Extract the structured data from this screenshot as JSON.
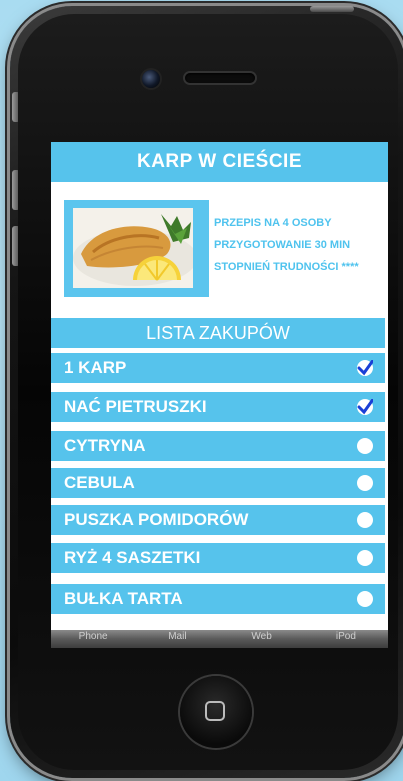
{
  "recipe": {
    "title": "KARP W CIEŚCIE",
    "info": [
      "PRZEPIS NA 4 OSOBY",
      "PRZYGOTOWANIE 30 MIN",
      "STOPNIEŃ TRUDNOŚCI ****"
    ]
  },
  "shopping": {
    "heading": "LISTA ZAKUPÓW",
    "items": [
      {
        "label": "1 KARP",
        "checked": true
      },
      {
        "label": "NAĆ PIETRUSZKI",
        "checked": true
      },
      {
        "label": "CYTRYNA",
        "checked": false
      },
      {
        "label": "CEBULA",
        "checked": false
      },
      {
        "label": "PUSZKA POMIDORÓW",
        "checked": false
      },
      {
        "label": "RYŻ 4 SASZETKI",
        "checked": false
      },
      {
        "label": "BUŁKA TARTA",
        "checked": false
      }
    ]
  },
  "tabbar": {
    "tabs": [
      "Phone",
      "Mail",
      "Web",
      "iPod"
    ]
  },
  "colors": {
    "accent": "#56c3ec",
    "info_text": "#4fc3ee",
    "check": "#1a3fd6"
  },
  "icons": {
    "checked": "checkmark-icon",
    "unchecked": "circle-icon"
  }
}
